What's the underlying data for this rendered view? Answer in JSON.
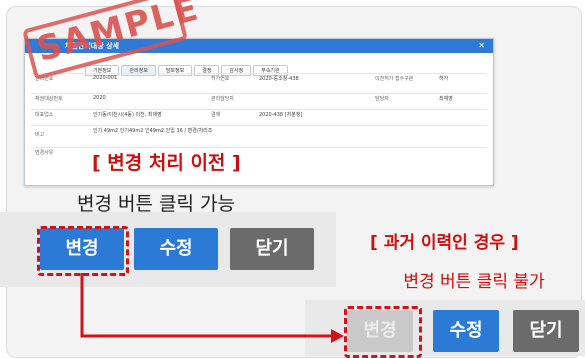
{
  "screenshot": {
    "window_title": "채권관리대상 상세",
    "tabs": [
      "기본정보",
      "관리정보",
      "담보정보",
      "결정",
      "감사정",
      "부속기관"
    ],
    "rows": [
      [
        "관리번호",
        "2020-001",
        "허가번호",
        "2020-중소청-438",
        "이전허가 접수구분",
        "허가"
      ],
      [
        "채권대상번호",
        "2020",
        "관리담당자",
        "",
        "담당자",
        "최재영"
      ],
      [
        "대표업소",
        "인기동/이천시(4동) 이천, 최재영",
        "결재",
        "2020-438 [처분청]",
        "",
        ""
      ],
      [
        "비고",
        "인기 49m2 인기49m2 인49m2 인입 36 / 변경/처리조",
        "",
        "",
        "",
        ""
      ],
      [
        "변경사유",
        "",
        "",
        "",
        "",
        ""
      ]
    ]
  },
  "stamp_text": "SAMPLE",
  "before": {
    "heading": "[ 변경 처리 이전 ]",
    "subtitle": "변경 버튼 클릭 가능",
    "buttons": {
      "change": "변경",
      "edit": "수정",
      "close": "닫기"
    }
  },
  "after": {
    "heading": "[ 과거 이력인 경우 ]",
    "subtitle": "변경 버튼 클릭 불가",
    "buttons": {
      "change": "변경",
      "edit": "수정",
      "close": "닫기"
    }
  },
  "colors": {
    "accent_red": "#d0121a",
    "button_blue": "#2a7ad6",
    "button_gray": "#6b6b6b",
    "disabled_gray": "#c9c9c9"
  }
}
